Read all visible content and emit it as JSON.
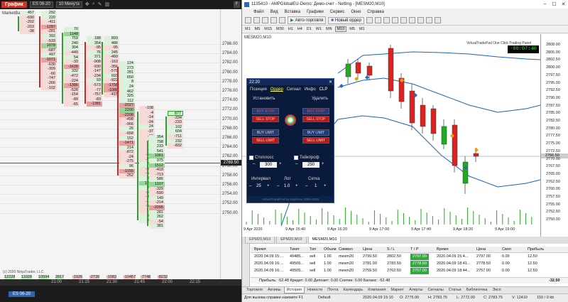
{
  "left": {
    "tab": "График",
    "symbol": "ES 06-20",
    "timeframe": "10 Минута",
    "market_balance": "MarketBalance",
    "price_ticks": [
      "2786.00",
      "2784.00",
      "2782.00",
      "2780.00",
      "2778.00",
      "2776.00",
      "2774.00",
      "2772.00",
      "2770.00",
      "2768.00",
      "2766.00",
      "2764.00",
      "2762.00",
      "2760.00",
      "2758.00",
      "2756.00",
      "2754.00",
      "2752.00",
      "2750.00"
    ],
    "current_price": "2769.50",
    "time_labels": [
      "21:00",
      "21:15",
      "21:30",
      "21:45",
      "22:00",
      "22:15"
    ],
    "columns": [
      {
        "cells": [
          "457",
          "-690",
          "-202",
          "-203",
          "-38"
        ]
      },
      {
        "cells": [
          "292",
          "220",
          "-411",
          "-1287",
          "-281",
          "392",
          "-533",
          "1978",
          "-687",
          "497",
          "-1071",
          "-630",
          "-309",
          "-66",
          "-747",
          "-266",
          "-102"
        ]
      },
      {
        "cells": [
          "70",
          "1148",
          "759",
          "240",
          "304",
          "-449",
          "54",
          "-33",
          "-1628",
          "332",
          "-472",
          "-224",
          "-1386",
          "-528",
          "-154",
          "-89",
          "-65"
        ]
      },
      {
        "cells": [
          "188",
          "354",
          "-95",
          "76",
          "371",
          "-908",
          "-930",
          "-147",
          "-234",
          "93",
          "-573",
          "-77",
          "-757",
          "-83",
          "-1381"
        ]
      },
      {
        "cells": [
          "893",
          "486",
          "-95",
          "245",
          "-460",
          "-163",
          "-356",
          "-579",
          "693",
          "-922",
          "-1758",
          "-1088",
          "-415"
        ]
      },
      {
        "cells": [
          "124",
          "273",
          "281",
          "650",
          "8",
          "24",
          "462",
          "325",
          "112",
          "-2027",
          "2200",
          "-2208",
          "-498",
          "-966",
          "26",
          "-658",
          "152",
          "-1471",
          "214",
          "-872",
          "-24",
          "-275",
          "96",
          "-1155",
          "-252"
        ]
      },
      {
        "cells": [
          "-108",
          "-4",
          "-14",
          "-24",
          "24",
          "-37",
          "-60",
          "-88",
          "-76",
          "-96",
          "-418",
          "-713",
          "252",
          "-443",
          "-634",
          "353",
          "1263",
          "816",
          "-623",
          "-486",
          "-172",
          "-503",
          "-54",
          "381",
          "331"
        ]
      },
      {
        "cells": [
          "354",
          "798",
          "233",
          "541",
          "1061",
          "975",
          "1512",
          "-418",
          "-713",
          "586",
          "1107",
          "-329",
          "-590",
          "149",
          "-214",
          "-2095",
          "281",
          "262",
          "-54",
          "381"
        ]
      },
      {
        "cells": [
          "877",
          "-334",
          "-233",
          "102",
          "604",
          "-711",
          "232",
          "-832"
        ]
      }
    ],
    "summary_row": [
      "12228",
      "11028",
      "10594",
      "2817",
      "-1926",
      "-2739",
      "-1083",
      "-10457",
      "-7748",
      "-8232"
    ],
    "summary_pct": [
      "0,2%",
      "0,1%",
      "0,1%",
      "0,1%",
      "-0,1%",
      "-0,1%",
      "-0,5%",
      "-0,6%",
      "-0,4%",
      "-0,4%"
    ],
    "footer": "(c) 2020 NinjaTrader, LLC",
    "bottom_tab": "ES 06-20"
  },
  "mt": {
    "title": "1135410 - AMPGlobalEU-Demo: Демо-счет - Netting - [MESM20,M10]",
    "menu": [
      "Файл",
      "Вид",
      "Вставка",
      "Графики",
      "Сервис",
      "Окно",
      "Справка"
    ],
    "toolbar_auto": "Авто-торговля",
    "toolbar_new": "Новый ордер",
    "timeframes": [
      "M1",
      "M5",
      "M15",
      "M30",
      "H1",
      "H4",
      "D1",
      "W1",
      "MN",
      "M10",
      "M5",
      "M1"
    ],
    "tf_active": "M10",
    "chart_symbol": "MESM20,M10",
    "vpt_label": "VirtualTradePad One Click Trading Panel",
    "timer": "-00:07:40",
    "price_ticks": [
      "2808.00",
      "2805.00",
      "2802.50",
      "2800.00",
      "2797.50",
      "2795.00",
      "2792.50",
      "2790.00",
      "2787.50",
      "2785.00",
      "2782.50",
      "2780.00",
      "2777.50",
      "2775.00",
      "2772.50",
      "2770.00",
      "2767.50",
      "2765.00",
      "2762.50",
      "2760.00",
      "2757.50",
      "2755.00",
      "2752.50",
      "2750.00"
    ],
    "current_price": "2766.50",
    "x_labels": [
      "9 Apr 2020",
      "9 Apr 15:40",
      "9 Apr 16:20",
      "9 Apr 17:00",
      "9 Apr 17:40",
      "9 Apr 18:20",
      "9 Apr 19:00"
    ],
    "chart_tabs": [
      "EPM20,M10",
      "EPM20,M10",
      "MESM20,M10"
    ],
    "chart_tab_active": 2,
    "panel": {
      "time": "22:20",
      "tabs": [
        "Позиция",
        "Ордер",
        "Сигнал",
        "Инфо",
        "CLP"
      ],
      "tab_active": 1,
      "left_title": "Установить",
      "right_title": "Удалить",
      "btn_buy_stop": "BUY STOP",
      "btn_sell_stop": "SELL STOP",
      "btn_buy_limit": "BUY LIMIT",
      "btn_sell_limit": "SELL LIMIT",
      "stoploss_label": "Стоплосс",
      "stoploss_value": "300",
      "takeprofit_label": "Тейкпроф",
      "takeprofit_value": "250",
      "interval_label": "Интервал",
      "interval_value": "25",
      "lot_label": "Лот",
      "lot_value": "1.0",
      "grid_label": "Сетка",
      "grid_value": "1",
      "footer": "VirtualTradePad by Expforex 2009-2020"
    },
    "terminal": {
      "headers": [
        "Время",
        "Тикет",
        "Тип",
        "Объем",
        "Символ",
        "Цена",
        "S / L",
        "T / P",
        "Время",
        "Цена",
        "Своп",
        "Прибыль"
      ],
      "rows": [
        [
          "2020.04.09 15:...",
          "49485...",
          "sell",
          "1.00",
          "mesm20",
          "2799.50",
          "2802.50",
          "2797.00",
          "2020.04.09 15:4...",
          "2797.00",
          "0.00",
          "12.50"
        ],
        [
          "2020.04.09 16:...",
          "49505...",
          "sell",
          "1.00",
          "mesm20",
          "2781.00",
          "2783.50",
          "2778.50",
          "2020.04.09 18:41...",
          "2778.50",
          "0.00",
          "12.50"
        ],
        [
          "2020.04.09 16:...",
          "49505...",
          "sell",
          "1.00",
          "mesm20",
          "2759.50",
          "2762.50",
          "2757.00",
          "2020.04.09 18:44...",
          "2757.00",
          "0.00",
          "12.50"
        ]
      ],
      "balance_line": "Прибыль: -52.48  Кредит: 0.00  Депозит: 0.00  Снятие: 0.00  Баланс: -52.48",
      "balance_total": "-32.50"
    },
    "terminal_tabs": [
      "Торговля",
      "Активы",
      "История",
      "Новости",
      "Почта",
      "Календарь",
      "Компания",
      "Маркет",
      "Алерты",
      "Сигналы",
      "Статьи",
      "Библиотека",
      "Эксп"
    ],
    "terminal_tab_active": 2,
    "status": {
      "help": "Для вызова справки нажмите F1",
      "profile": "Default",
      "datetime": "2020.04.09 15:10",
      "open": "O: 2775.00",
      "high": "H: 2783.75",
      "low": "L: 2772.00",
      "close": "C: 2783.75",
      "volume": "V: 12410",
      "memory": "150 / 0 kb"
    }
  },
  "colors": {
    "accent_red": "#c0392b",
    "tp_green": "#31a83e",
    "candle_bull": "#22aa22",
    "candle_bear": "#dd2222",
    "band": "#1565c0"
  }
}
